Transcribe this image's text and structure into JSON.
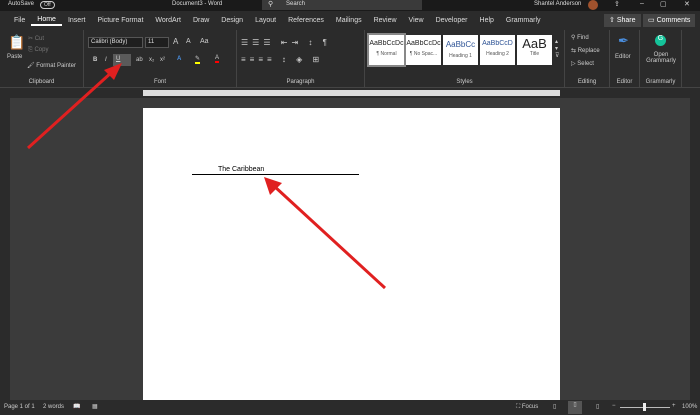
{
  "titlebar": {
    "autosave": "AutoSave",
    "autosave_state": "Off",
    "doc_title": "Document3 - Word",
    "search": "Search",
    "user": "Shantel Anderson"
  },
  "tabs": [
    "File",
    "Home",
    "Insert",
    "Picture Format",
    "WordArt",
    "Draw",
    "Design",
    "Layout",
    "References",
    "Mailings",
    "Review",
    "View",
    "Developer",
    "Help",
    "Grammarly"
  ],
  "share": "Share",
  "comments": "Comments",
  "clipboard": {
    "paste": "Paste",
    "cut": "Cut",
    "copy": "Copy",
    "format_painter": "Format Painter",
    "label": "Clipboard"
  },
  "font": {
    "name": "Calibri (Body)",
    "size": "11",
    "label": "Font",
    "bold": "B",
    "italic": "I",
    "underline": "U",
    "grow": "A",
    "shrink": "A",
    "case": "Aa"
  },
  "paragraph": {
    "label": "Paragraph"
  },
  "styles": {
    "label": "Styles",
    "items": [
      {
        "preview": "AaBbCcDc",
        "name": "¶ Normal"
      },
      {
        "preview": "AaBbCcDc",
        "name": "¶ No Spac..."
      },
      {
        "preview": "AaBbCc",
        "name": "Heading 1"
      },
      {
        "preview": "AaBbCcD",
        "name": "Heading 2"
      },
      {
        "preview": "AaB",
        "name": "Title"
      }
    ]
  },
  "editing": {
    "find": "Find",
    "replace": "Replace",
    "select": "Select",
    "label": "Editing"
  },
  "editor": {
    "button": "Editor",
    "label": "Editor"
  },
  "grammarly": {
    "button": "Open Grammarly",
    "label": "Grammarly"
  },
  "document": {
    "text": "The Caribbean"
  },
  "status": {
    "page": "Page 1 of 1",
    "words": "2 words",
    "focus": "Focus",
    "zoom": "100%"
  },
  "colors": {
    "accent_red": "#e02020",
    "highlight": "#ffff00",
    "font_color": "#ff0000"
  }
}
